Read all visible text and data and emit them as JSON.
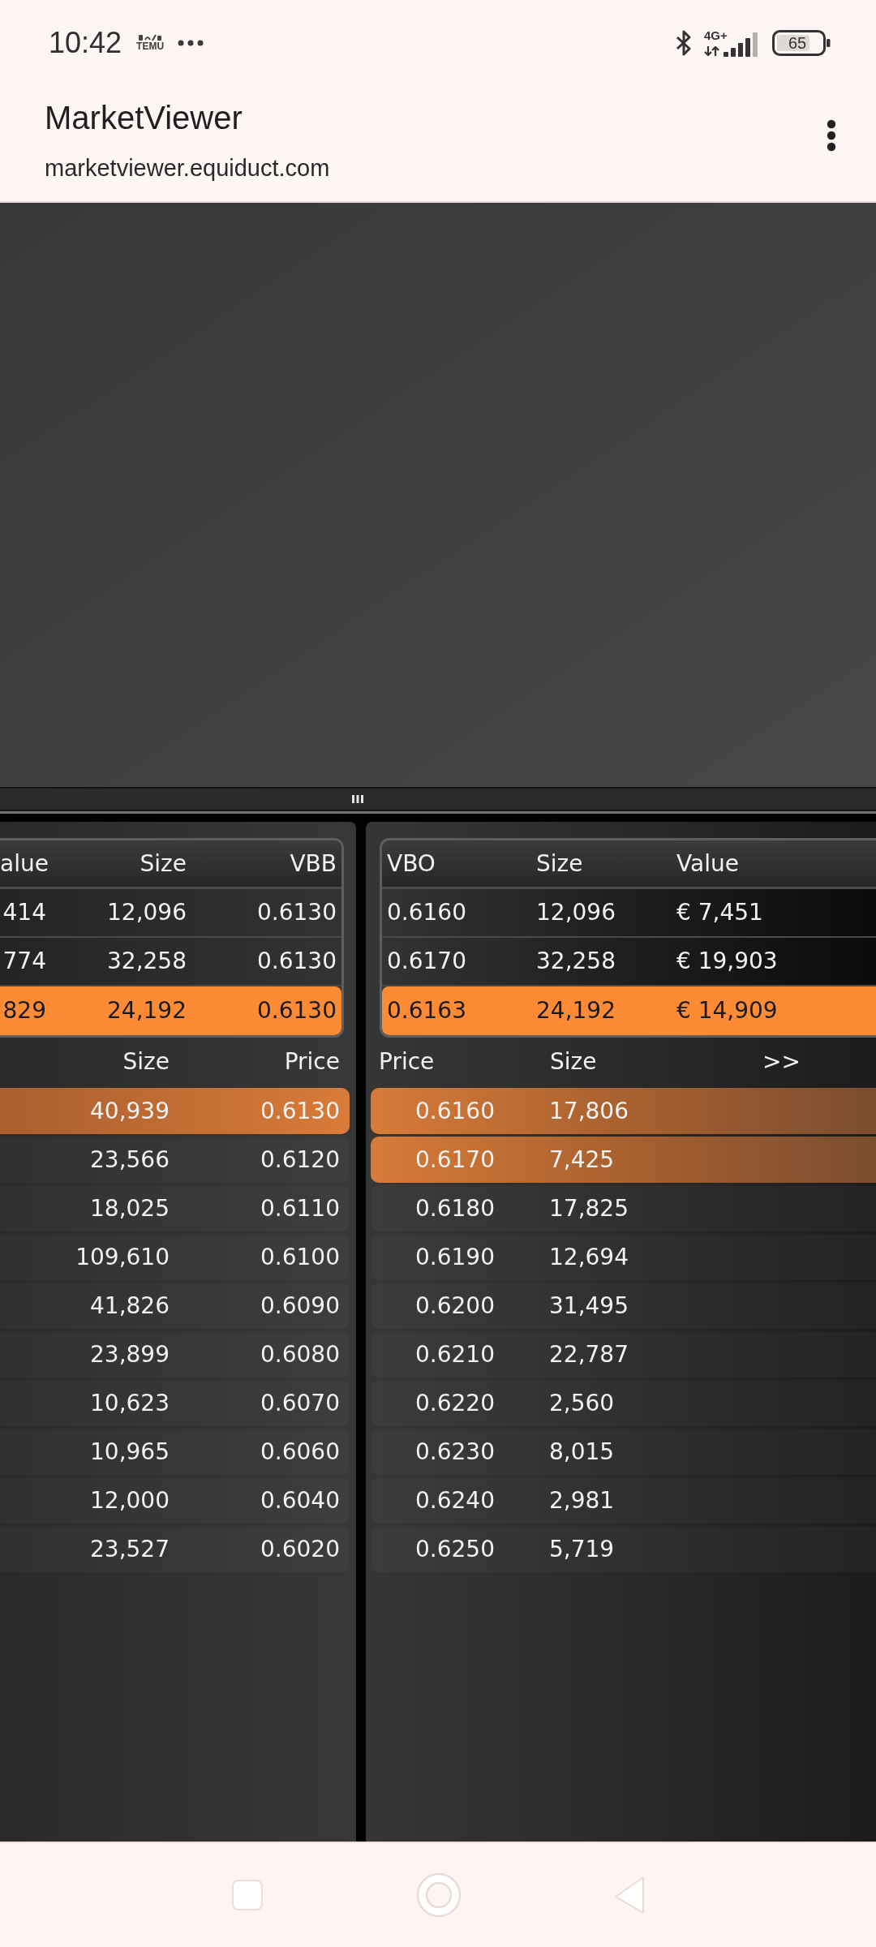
{
  "status_bar": {
    "time": "10:42",
    "app_notification": "TEMU",
    "network": "4G+",
    "battery": "65"
  },
  "browser_header": {
    "title": "MarketViewer",
    "url": "marketviewer.equiduct.com"
  },
  "bid_summary": {
    "columns": [
      "alue",
      "Size",
      "VBB"
    ],
    "rows": [
      {
        "cells": [
          "414",
          "12,096",
          "0.6130"
        ],
        "highlighted": false
      },
      {
        "cells": [
          "774",
          "32,258",
          "0.6130"
        ],
        "highlighted": false
      },
      {
        "cells": [
          "829",
          "24,192",
          "0.6130"
        ],
        "highlighted": true
      }
    ]
  },
  "offer_summary": {
    "columns": [
      "VBO",
      "Size",
      "Value"
    ],
    "rows": [
      {
        "cells": [
          "0.6160",
          "12,096",
          "€ 7,451"
        ],
        "highlighted": false
      },
      {
        "cells": [
          "0.6170",
          "32,258",
          "€ 19,903"
        ],
        "highlighted": false
      },
      {
        "cells": [
          "0.6163",
          "24,192",
          "€ 14,909"
        ],
        "highlighted": true
      }
    ]
  },
  "bid_book": {
    "columns": [
      "Size",
      "Price"
    ],
    "rows": [
      {
        "size": "40,939",
        "price": "0.6130",
        "highlighted": true
      },
      {
        "size": "23,566",
        "price": "0.6120",
        "highlighted": false
      },
      {
        "size": "18,025",
        "price": "0.6110",
        "highlighted": false
      },
      {
        "size": "109,610",
        "price": "0.6100",
        "highlighted": false
      },
      {
        "size": "41,826",
        "price": "0.6090",
        "highlighted": false
      },
      {
        "size": "23,899",
        "price": "0.6080",
        "highlighted": false
      },
      {
        "size": "10,623",
        "price": "0.6070",
        "highlighted": false
      },
      {
        "size": "10,965",
        "price": "0.6060",
        "highlighted": false
      },
      {
        "size": "12,000",
        "price": "0.6040",
        "highlighted": false
      },
      {
        "size": "23,527",
        "price": "0.6020",
        "highlighted": false
      }
    ]
  },
  "offer_book": {
    "columns": [
      "Price",
      "Size"
    ],
    "expand": ">>",
    "rows": [
      {
        "price": "0.6160",
        "size": "17,806",
        "highlighted": true
      },
      {
        "price": "0.6170",
        "size": "7,425",
        "highlighted": true
      },
      {
        "price": "0.6180",
        "size": "17,825",
        "highlighted": false
      },
      {
        "price": "0.6190",
        "size": "12,694",
        "highlighted": false
      },
      {
        "price": "0.6200",
        "size": "31,495",
        "highlighted": false
      },
      {
        "price": "0.6210",
        "size": "22,787",
        "highlighted": false
      },
      {
        "price": "0.6220",
        "size": "2,560",
        "highlighted": false
      },
      {
        "price": "0.6230",
        "size": "8,015",
        "highlighted": false
      },
      {
        "price": "0.6240",
        "size": "2,981",
        "highlighted": false
      },
      {
        "price": "0.6250",
        "size": "5,719",
        "highlighted": false
      }
    ]
  }
}
